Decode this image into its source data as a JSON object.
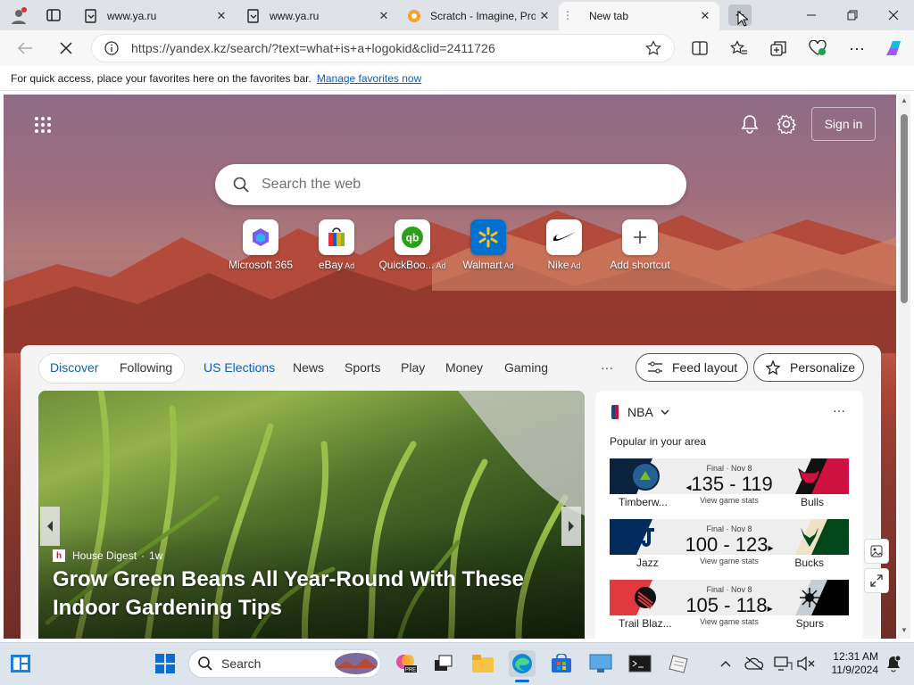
{
  "tabs": [
    {
      "title": "www.ya.ru",
      "favicon": "page-icon"
    },
    {
      "title": "www.ya.ru",
      "favicon": "page-icon"
    },
    {
      "title": "Scratch - Imagine, Pro",
      "favicon": "scratch-icon"
    },
    {
      "title": "New tab",
      "favicon": "edge-icon"
    }
  ],
  "address": {
    "url": "https://yandex.kz/search/?text=what+is+a+logokid&clid=2411726"
  },
  "favbar": {
    "text": "For quick access, place your favorites here on the favorites bar.",
    "link": "Manage favorites now"
  },
  "header": {
    "signin": "Sign in"
  },
  "search": {
    "placeholder": "Search the web"
  },
  "tiles": [
    {
      "label": "Microsoft 365",
      "ad": ""
    },
    {
      "label": "eBay",
      "ad": "Ad"
    },
    {
      "label": "QuickBoo...",
      "ad": "Ad"
    },
    {
      "label": "Walmart",
      "ad": "Ad"
    },
    {
      "label": "Nike",
      "ad": "Ad"
    },
    {
      "label": "Add shortcut",
      "ad": ""
    }
  ],
  "feednav": {
    "discover": "Discover",
    "following": "Following",
    "items": [
      "US Elections",
      "News",
      "Sports",
      "Play",
      "Money",
      "Gaming"
    ],
    "more": "···",
    "feed_layout": "Feed layout",
    "personalize": "Personalize"
  },
  "hero": {
    "source": "House Digest",
    "age": "1w",
    "headline": "Grow Green Beans All Year-Round With These Indoor Gardening Tips"
  },
  "nba": {
    "title": "NBA",
    "subtitle": "Popular in your area",
    "games": [
      {
        "status": "Final · Nov 8",
        "score": "135 - 119",
        "stats": "View game stats",
        "team1": "Timberw...",
        "team2": "Bulls",
        "color1": "#0c2340",
        "color2": "#ce1141"
      },
      {
        "status": "Final · Nov 8",
        "score": "100 - 123",
        "stats": "View game stats",
        "team1": "Jazz",
        "team2": "Bucks",
        "color1": "#002b5c",
        "color2": "#00471b"
      },
      {
        "status": "Final · Nov 8",
        "score": "105 - 118",
        "stats": "View game stats",
        "team1": "Trail Blaz...",
        "team2": "Spurs",
        "color1": "#e03a3e",
        "color2": "#000000"
      }
    ]
  },
  "taskbar": {
    "search": "Search",
    "time": "12:31 AM",
    "date": "11/9/2024"
  }
}
